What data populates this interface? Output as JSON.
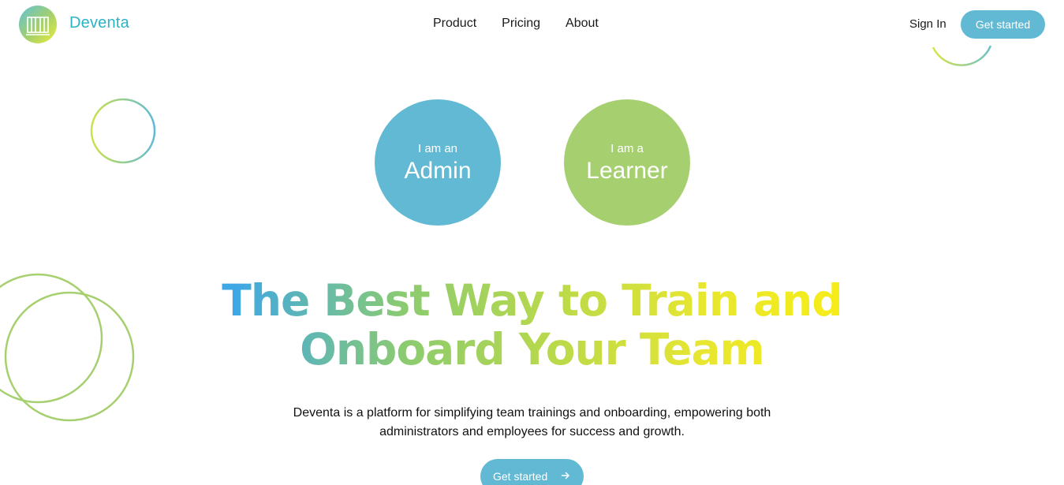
{
  "header": {
    "brand": "Deventa",
    "nav": [
      {
        "label": "Product"
      },
      {
        "label": "Pricing"
      },
      {
        "label": "About"
      }
    ],
    "sign_in": "Sign In",
    "get_started": "Get started"
  },
  "roles": {
    "admin": {
      "prefix": "I am an",
      "title": "Admin",
      "color": "#61b9d3"
    },
    "learner": {
      "prefix": "I am a",
      "title": "Learner",
      "color": "#a6d06f"
    }
  },
  "hero": {
    "headline_line1": "The Best Way to Train and",
    "headline_line2": "Onboard Your Team",
    "description_line1": "Deventa is a platform for simplifying team trainings and onboarding, empowering both",
    "description_line2": "administrators and employees for success and growth.",
    "cta": "Get started"
  },
  "colors": {
    "accent_blue": "#61b9d3",
    "accent_green": "#a6d06f",
    "brand_text": "#2bb3c6"
  },
  "icons": {
    "logo": "building-columns-icon",
    "cta_arrow": "arrow-right-icon"
  }
}
